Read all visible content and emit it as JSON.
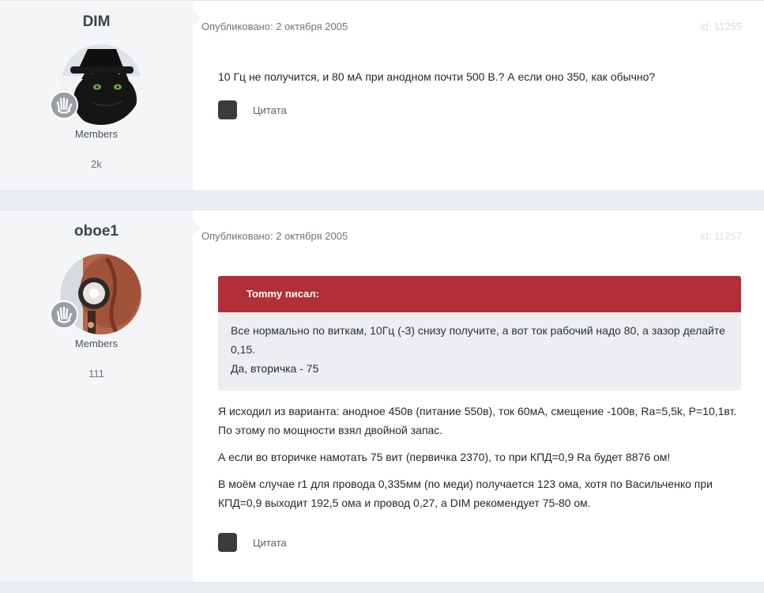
{
  "posts": [
    {
      "username": "DIM",
      "avatar_icon": "black-cat-avatar-icon",
      "badge_icon": "hand-wave-badge-icon",
      "group": "Members",
      "post_count": "2k",
      "published": "Опубликовано: 2 октября 2005",
      "id_label": "id: 11255",
      "paragraphs": [
        "10 Гц не получится, и 80 мА при анодном почти 500 В.? А если оно 350, как обычно?"
      ],
      "quote_button": "Цитата"
    },
    {
      "username": "oboe1",
      "avatar_icon": "tube-photo-avatar-icon",
      "badge_icon": "hand-wave-badge-icon",
      "group": "Members",
      "post_count": "111",
      "published": "Опубликовано: 2 октября 2005",
      "id_label": "id: 11257",
      "quote": {
        "header": "Tommy писал:",
        "lines": [
          "Все нормально по виткам, 10Гц (-3) снизу получите, а вот ток рабочий надо 80, а зазор делайте 0,15.",
          "Да, вторичка - 75"
        ]
      },
      "paragraphs": [
        "Я исходил из варианта: анодное 450в (питание 550в), ток 60мА, смещение -100в, Ra=5,5k, P=10,1вт. По этому по мощности взял двойной запас.",
        "А если во вторичке намотать 75 вит (первичка 2370), то при КПД=0,9 Ra будет 8876 ом!",
        "В моём случае r1 для провода 0,335мм (по меди) получается 123 ома, хотя по Васильченко при КПД=0,9 выходит 192,5 ома и провод 0,27, а DIM рекомендует 75-80 ом."
      ],
      "quote_button": "Цитата"
    }
  ],
  "colors": {
    "quote_header": "#b12f37",
    "quote_background": "#eceef1",
    "author_panel": "#f4f5f7"
  }
}
